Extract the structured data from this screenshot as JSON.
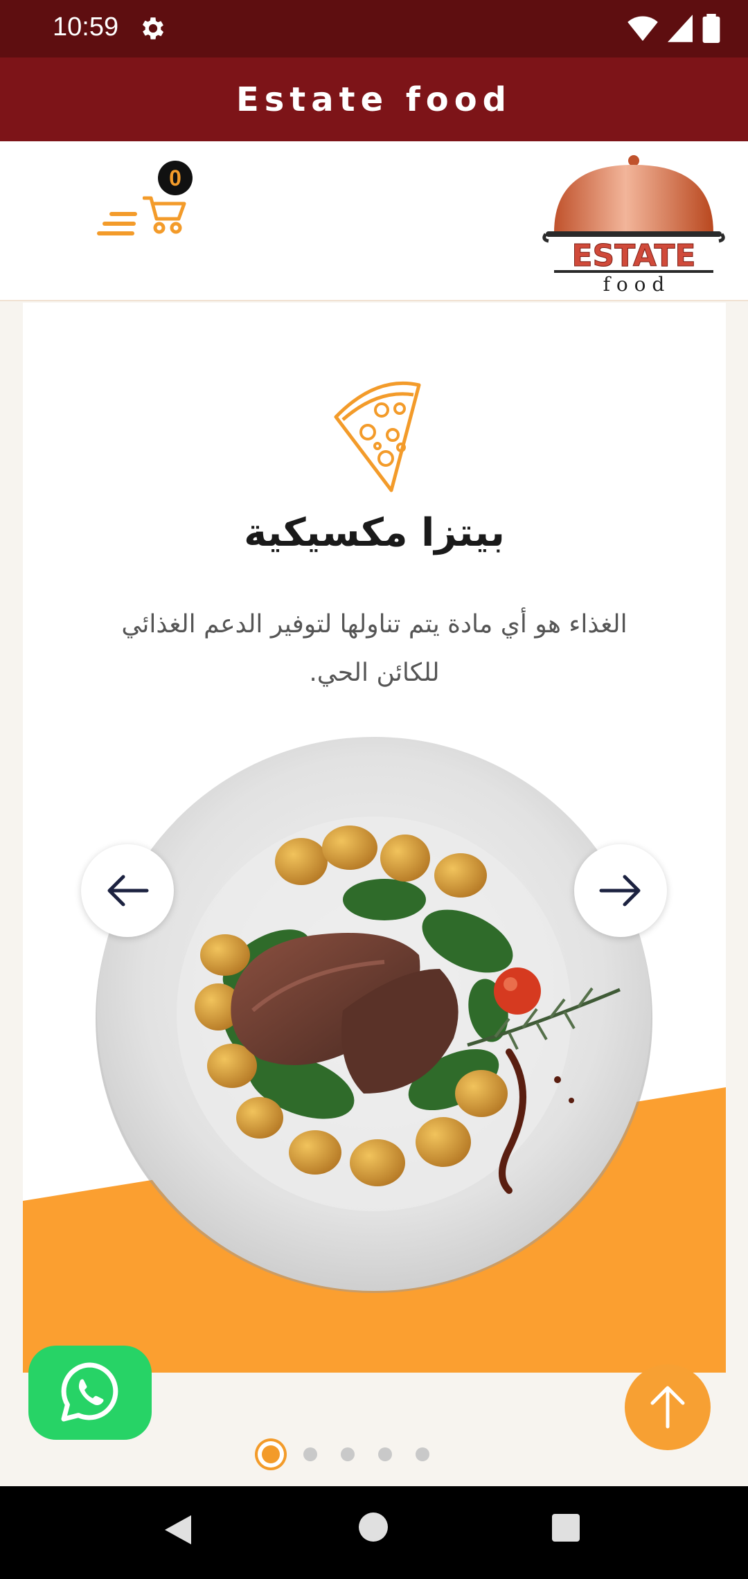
{
  "status_bar": {
    "time": "10:59"
  },
  "app_bar": {
    "title": "Estate food"
  },
  "header": {
    "cart_count": "0",
    "logo_top": "ESTATE",
    "logo_bottom": "f o o d"
  },
  "slider": {
    "title": "بيتزا مكسيكية",
    "description": "الغذاء هو أي مادة يتم تناولها لتوفير الدعم الغذائي للكائن الحي.",
    "active_slide": 1,
    "total_slides": 5
  },
  "colors": {
    "brand": "#7d1418",
    "accent": "#f39b2a",
    "whatsapp": "#27d366"
  }
}
